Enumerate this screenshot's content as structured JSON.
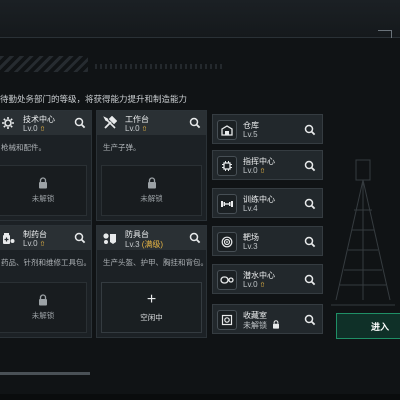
{
  "description": "待勤处务部门的等级，将获得能力提升和制造能力",
  "workshops": [
    {
      "id": "tech",
      "title": "技术中心",
      "level": "Lv.0",
      "upgradable": true,
      "desc": "枪械和配件。",
      "slot": "未解锁",
      "icon": "gear-icon"
    },
    {
      "id": "workbench",
      "title": "工作台",
      "level": "Lv.0",
      "upgradable": true,
      "desc": "生产子弹。",
      "slot": "未解锁",
      "icon": "hammer-wrench-icon"
    },
    {
      "id": "pharmacy",
      "title": "制药台",
      "level": "Lv.0",
      "upgradable": true,
      "desc": "药品、针剂和维修工具包。",
      "slot": "未解锁",
      "icon": "medicine-icon"
    },
    {
      "id": "armor",
      "title": "防具台",
      "level": "Lv.3",
      "max": "(满级)",
      "upgradable": false,
      "desc": "生产头盔、护甲、胸挂和背包。",
      "slot": "空闲中",
      "slot_idle": true,
      "icon": "armor-icon"
    }
  ],
  "facilities": [
    {
      "title": "仓库",
      "level": "Lv.5",
      "upgradable": false,
      "icon": "warehouse-icon"
    },
    {
      "title": "指挥中心",
      "level": "Lv.0",
      "upgradable": true,
      "icon": "chip-icon"
    },
    {
      "title": "训练中心",
      "level": "Lv.4",
      "upgradable": false,
      "icon": "dumbbell-icon"
    },
    {
      "title": "靶场",
      "level": "Lv.3",
      "upgradable": false,
      "icon": "target-icon"
    },
    {
      "title": "潜水中心",
      "level": "Lv.0",
      "upgradable": true,
      "icon": "diving-icon"
    },
    {
      "title": "收藏室",
      "level": "未解锁",
      "locked": true,
      "icon": "vault-icon"
    }
  ],
  "enter_label": "进入",
  "colors": {
    "accent_gold": "#e8b645",
    "enter_green": "#1f8f66",
    "card_bg": "#1c2125"
  }
}
